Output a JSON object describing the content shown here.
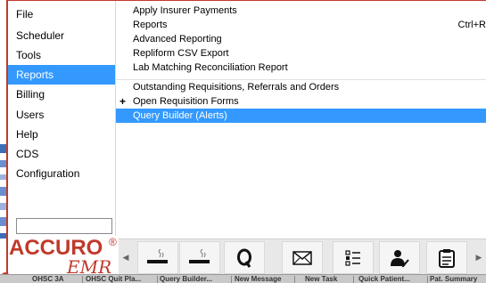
{
  "left_menu": {
    "items": [
      {
        "label": "File",
        "selected": false
      },
      {
        "label": "Scheduler",
        "selected": false
      },
      {
        "label": "Tools",
        "selected": false
      },
      {
        "label": "Reports",
        "selected": true
      },
      {
        "label": "Billing",
        "selected": false
      },
      {
        "label": "Users",
        "selected": false
      },
      {
        "label": "Help",
        "selected": false
      },
      {
        "label": "CDS",
        "selected": false
      },
      {
        "label": "Configuration",
        "selected": false
      }
    ],
    "search_value": ""
  },
  "reports_submenu": {
    "items": [
      {
        "label": "Apply Insurer Payments",
        "accelerator": "",
        "prefix": "",
        "highlighted": false
      },
      {
        "label": "Reports",
        "accelerator": "Ctrl+R",
        "prefix": "",
        "highlighted": false
      },
      {
        "label": "Advanced Reporting",
        "accelerator": "",
        "prefix": "",
        "highlighted": false
      },
      {
        "label": "Repliform CSV Export",
        "accelerator": "",
        "prefix": "",
        "highlighted": false
      },
      {
        "label": "Lab Matching Reconciliation Report",
        "accelerator": "",
        "prefix": "",
        "highlighted": false
      },
      {
        "label": "Outstanding Requisitions, Referrals and Orders",
        "accelerator": "",
        "prefix": "",
        "highlighted": false
      },
      {
        "label": "Open Requisition Forms",
        "accelerator": "",
        "prefix": "+",
        "highlighted": false
      },
      {
        "label": "Query Builder (Alerts)",
        "accelerator": "",
        "prefix": "",
        "highlighted": true
      }
    ]
  },
  "logo": {
    "brand": "ACCURO",
    "registered": "®",
    "product": "EMR"
  },
  "toolbar": {
    "scroll_left_icon": "left-arrow-icon",
    "scroll_right_icon": "right-arrow-icon",
    "buttons": [
      "cigarette-icon",
      "cigarette-icon",
      "query-q-icon",
      "envelope-icon",
      "list-icon",
      "user-check-icon",
      "clipboard-icon"
    ]
  },
  "taskbar": {
    "items": [
      "OHSC 3A",
      "OHSC Quit Pla...",
      "Query Builder...",
      "New Message",
      "New Task",
      "Quick Patient...",
      "Pat. Summary"
    ]
  },
  "colors": {
    "accent": "#3399ff",
    "brand": "#c0392b"
  }
}
